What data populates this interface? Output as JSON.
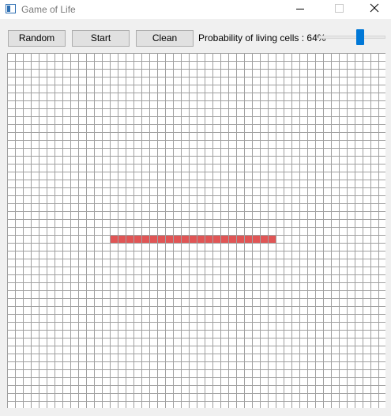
{
  "window": {
    "title": "Game of Life"
  },
  "toolbar": {
    "random_label": "Random",
    "start_label": "Start",
    "clean_label": "Clean",
    "probability_label": "Probability of living cells : 64%",
    "probability_value": 0.64
  },
  "colors": {
    "grid_line": "#a0a0a0",
    "grid_background": "#ffffff",
    "live_cell": "#e05555",
    "slider_handle": "#0078d7"
  },
  "board": {
    "columns": 48,
    "rows": 45,
    "live_cells": [
      [
        23,
        13
      ],
      [
        23,
        14
      ],
      [
        23,
        15
      ],
      [
        23,
        16
      ],
      [
        23,
        17
      ],
      [
        23,
        18
      ],
      [
        23,
        19
      ],
      [
        23,
        20
      ],
      [
        23,
        21
      ],
      [
        23,
        22
      ],
      [
        23,
        23
      ],
      [
        23,
        24
      ],
      [
        23,
        25
      ],
      [
        23,
        26
      ],
      [
        23,
        27
      ],
      [
        23,
        28
      ],
      [
        23,
        29
      ],
      [
        23,
        30
      ],
      [
        23,
        31
      ],
      [
        23,
        32
      ],
      [
        23,
        33
      ]
    ]
  }
}
